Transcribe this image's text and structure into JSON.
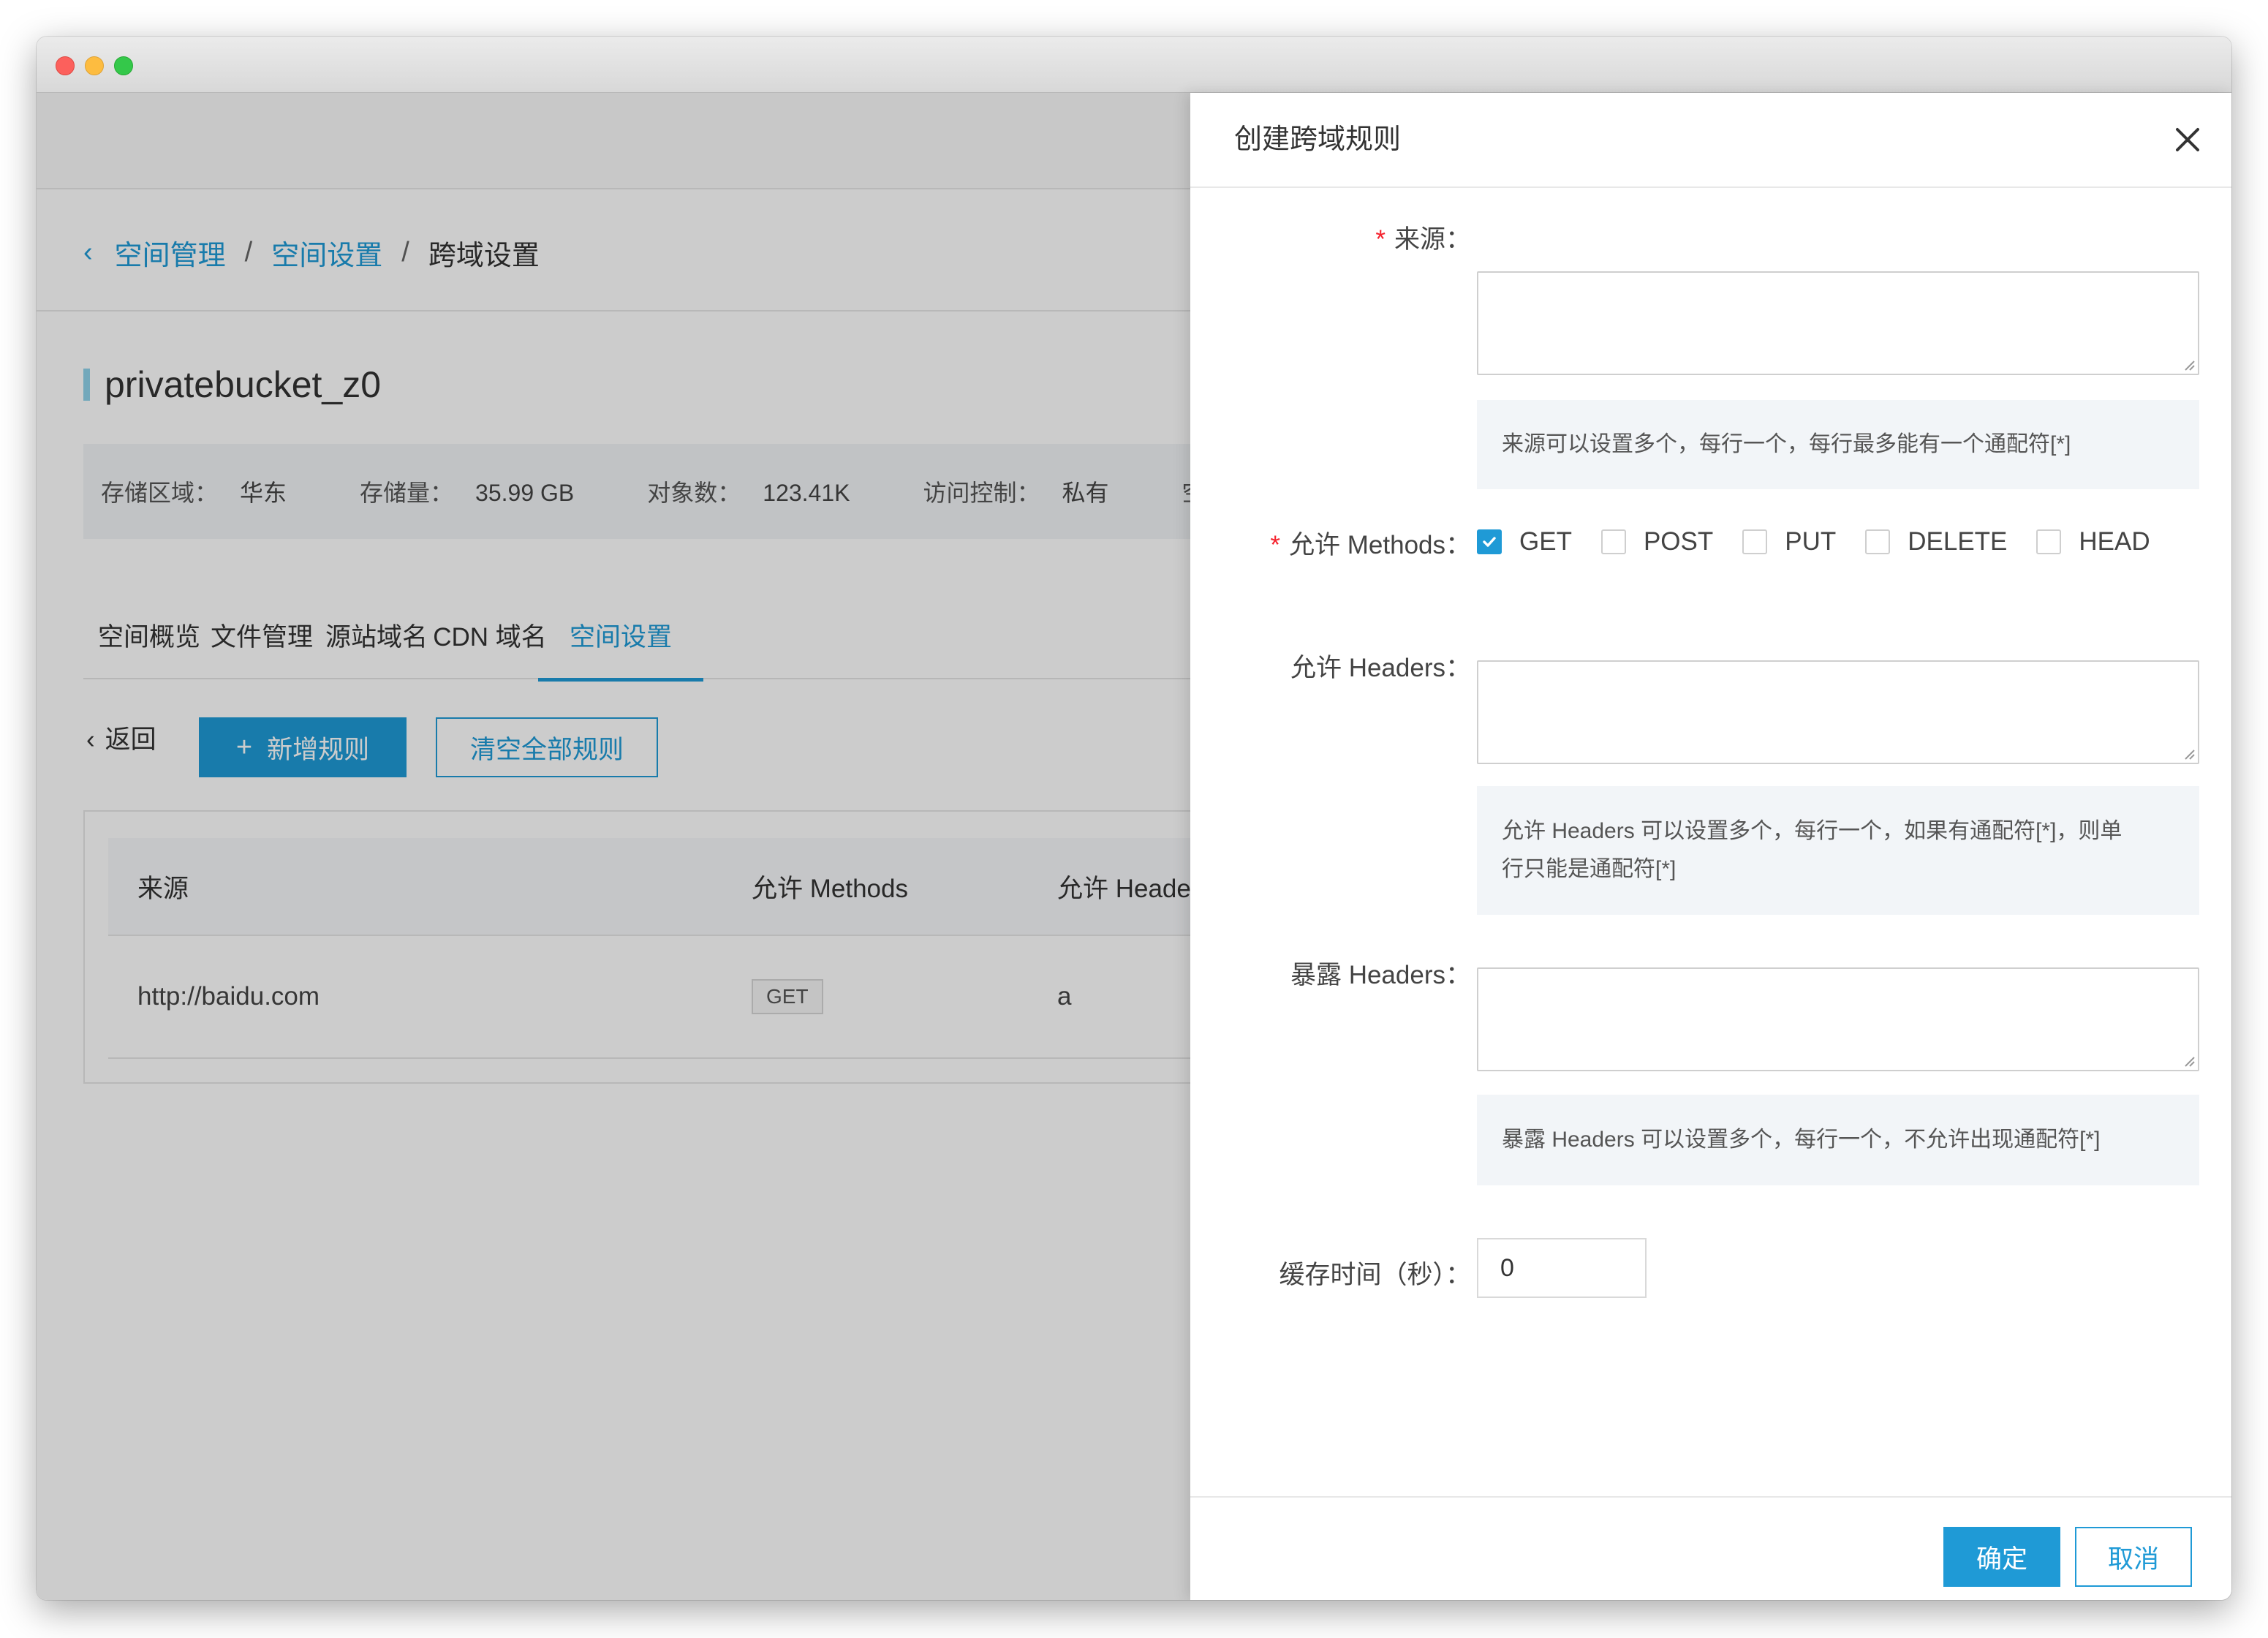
{
  "breadcrumb": {
    "items": [
      "空间管理",
      "空间设置"
    ],
    "separator": "/",
    "current": "跨域设置"
  },
  "bucket": {
    "name": "privatebucket_z0"
  },
  "info": [
    {
      "label": "存储区域：",
      "value": "华东"
    },
    {
      "label": "存储量：",
      "value": "35.99 GB"
    },
    {
      "label": "对象数：",
      "value": "123.41K"
    },
    {
      "label": "访问控制：",
      "value": "私有"
    },
    {
      "label": "空",
      "value": ""
    }
  ],
  "tabs": [
    "空间概览",
    "文件管理",
    "源站域名",
    "CDN 域名",
    "空间设置"
  ],
  "toolbar": {
    "back": "返回",
    "add": "新增规则",
    "clear": "清空全部规则"
  },
  "table": {
    "headers": [
      "来源",
      "允许 Methods",
      "允许 Header"
    ],
    "rows": [
      {
        "origin": "http://baidu.com",
        "method": "GET",
        "headers": "a"
      }
    ]
  },
  "drawer": {
    "title": "创建跨域规则",
    "origin_label": "来源：",
    "origin_hint": "来源可以设置多个，每行一个，每行最多能有一个通配符[*]",
    "methods_label": "允许 Methods：",
    "methods": [
      {
        "label": "GET",
        "checked": true
      },
      {
        "label": "POST",
        "checked": false
      },
      {
        "label": "PUT",
        "checked": false
      },
      {
        "label": "DELETE",
        "checked": false
      },
      {
        "label": "HEAD",
        "checked": false
      }
    ],
    "allow_headers_label": "允许 Headers：",
    "allow_headers_hint_1": "允许 Headers 可以设置多个，每行一个，如果有通配符[*]，则单",
    "allow_headers_hint_2": "行只能是通配符[*]",
    "expose_headers_label": "暴露 Headers：",
    "expose_headers_hint": "暴露 Headers 可以设置多个，每行一个，不允许出现通配符[*]",
    "cache_label": "缓存时间（秒）：",
    "cache_value": "0",
    "ok": "确定",
    "cancel": "取消"
  },
  "colors": {
    "accent": "#1f9ad6",
    "required": "#f5222d",
    "hint_bg": "#f2f5f8"
  }
}
